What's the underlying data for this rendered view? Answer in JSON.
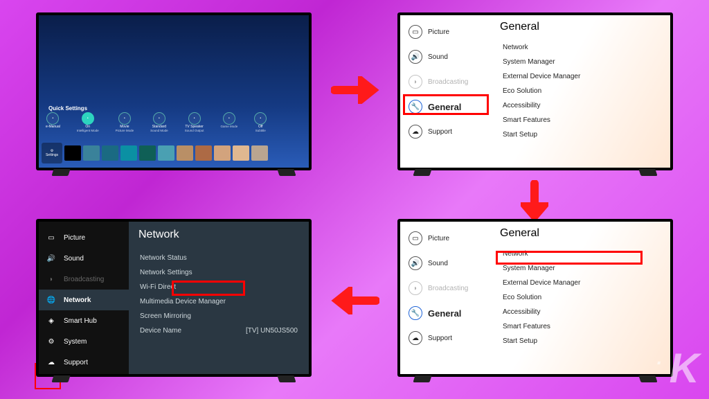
{
  "tv1": {
    "quick_settings_title": "Quick Settings",
    "items": [
      {
        "label": "e-Manual",
        "sub": ""
      },
      {
        "label": "On",
        "sub": "Intelligent Mode",
        "selected": true
      },
      {
        "label": "Movie",
        "sub": "Picture Mode"
      },
      {
        "label": "Standard",
        "sub": "Sound Mode"
      },
      {
        "label": "TV Speaker",
        "sub": "Sound Output"
      },
      {
        "label": "",
        "sub": "Game Mode"
      },
      {
        "label": "Off",
        "sub": "Subtitle"
      }
    ],
    "settings_label": "Settings",
    "tile_colors": [
      "#000",
      "#3a829a",
      "#1a6a82",
      "#0b90a3",
      "#0f5f56",
      "#4aa0b2",
      "#b98f66",
      "#ad6a45",
      "#d2a37d",
      "#e0b890",
      "#b9a590"
    ]
  },
  "light": {
    "side": [
      {
        "icon": "picture",
        "label": "Picture"
      },
      {
        "icon": "sound",
        "label": "Sound"
      },
      {
        "icon": "broadcast",
        "label": "Broadcasting",
        "disabled": true
      },
      {
        "icon": "general",
        "label": "General",
        "selected": true
      },
      {
        "icon": "support",
        "label": "Support"
      }
    ],
    "title": "General",
    "options": [
      "Network",
      "System Manager",
      "External Device Manager",
      "Eco Solution",
      "Accessibility",
      "Smart Features",
      "Start Setup"
    ]
  },
  "dark": {
    "side": [
      {
        "icon": "picture",
        "label": "Picture"
      },
      {
        "icon": "sound",
        "label": "Sound"
      },
      {
        "icon": "broadcast",
        "label": "Broadcasting",
        "disabled": true
      },
      {
        "icon": "network",
        "label": "Network",
        "selected": true
      },
      {
        "icon": "smarthub",
        "label": "Smart Hub"
      },
      {
        "icon": "system",
        "label": "System"
      },
      {
        "icon": "support",
        "label": "Support"
      }
    ],
    "title": "Network",
    "options": [
      {
        "label": "Network Status"
      },
      {
        "label": "Network Settings",
        "highlight": true
      },
      {
        "label": "Wi-Fi Direct"
      },
      {
        "label": "Multimedia Device Manager"
      },
      {
        "label": "Screen Mirroring"
      },
      {
        "label": "Device Name",
        "value": "[TV] UN50JS500"
      }
    ]
  },
  "watermark": "K"
}
